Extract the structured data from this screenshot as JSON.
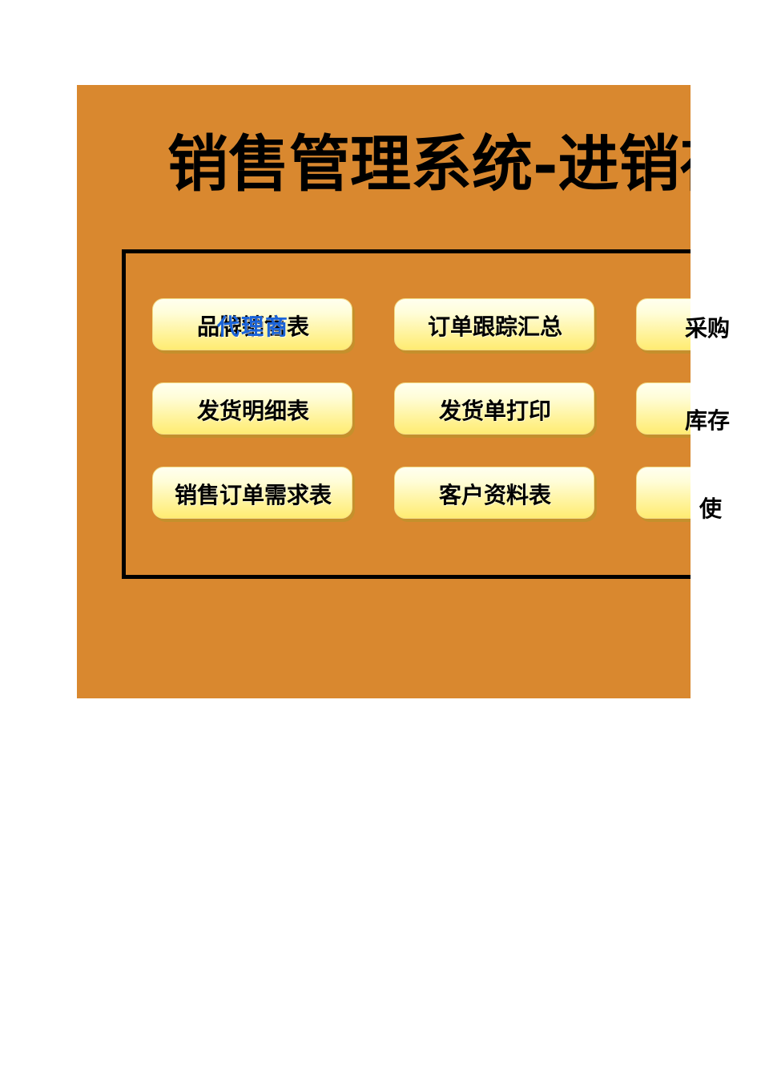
{
  "page": {
    "title": "销售管理系统-进销存",
    "background_color": "#ffffff",
    "panel_color": "#d9882f",
    "box_border_color": "#000000",
    "button_top_color": "#fffff0",
    "button_bottom_color": "#ffec72",
    "button_shadow_color": "#c4902c",
    "label_color": "#000000",
    "overlay_label_color": "#1a63d8"
  },
  "buttons": {
    "row1": [
      {
        "label": "品牌销售表",
        "overlay_label": "代理商"
      },
      {
        "label": "订单跟踪汇总",
        "overlay_label": ""
      },
      {
        "label": "采购",
        "overlay_label": ""
      }
    ],
    "row2": [
      {
        "label": "发货明细表",
        "overlay_label": ""
      },
      {
        "label": "发货单打印",
        "overlay_label": ""
      },
      {
        "label": "库存",
        "overlay_label": ""
      }
    ],
    "row3": [
      {
        "label": "销售订单需求表",
        "overlay_label": ""
      },
      {
        "label": "客户资料表",
        "overlay_label": ""
      },
      {
        "label": "使",
        "overlay_label": ""
      }
    ]
  }
}
